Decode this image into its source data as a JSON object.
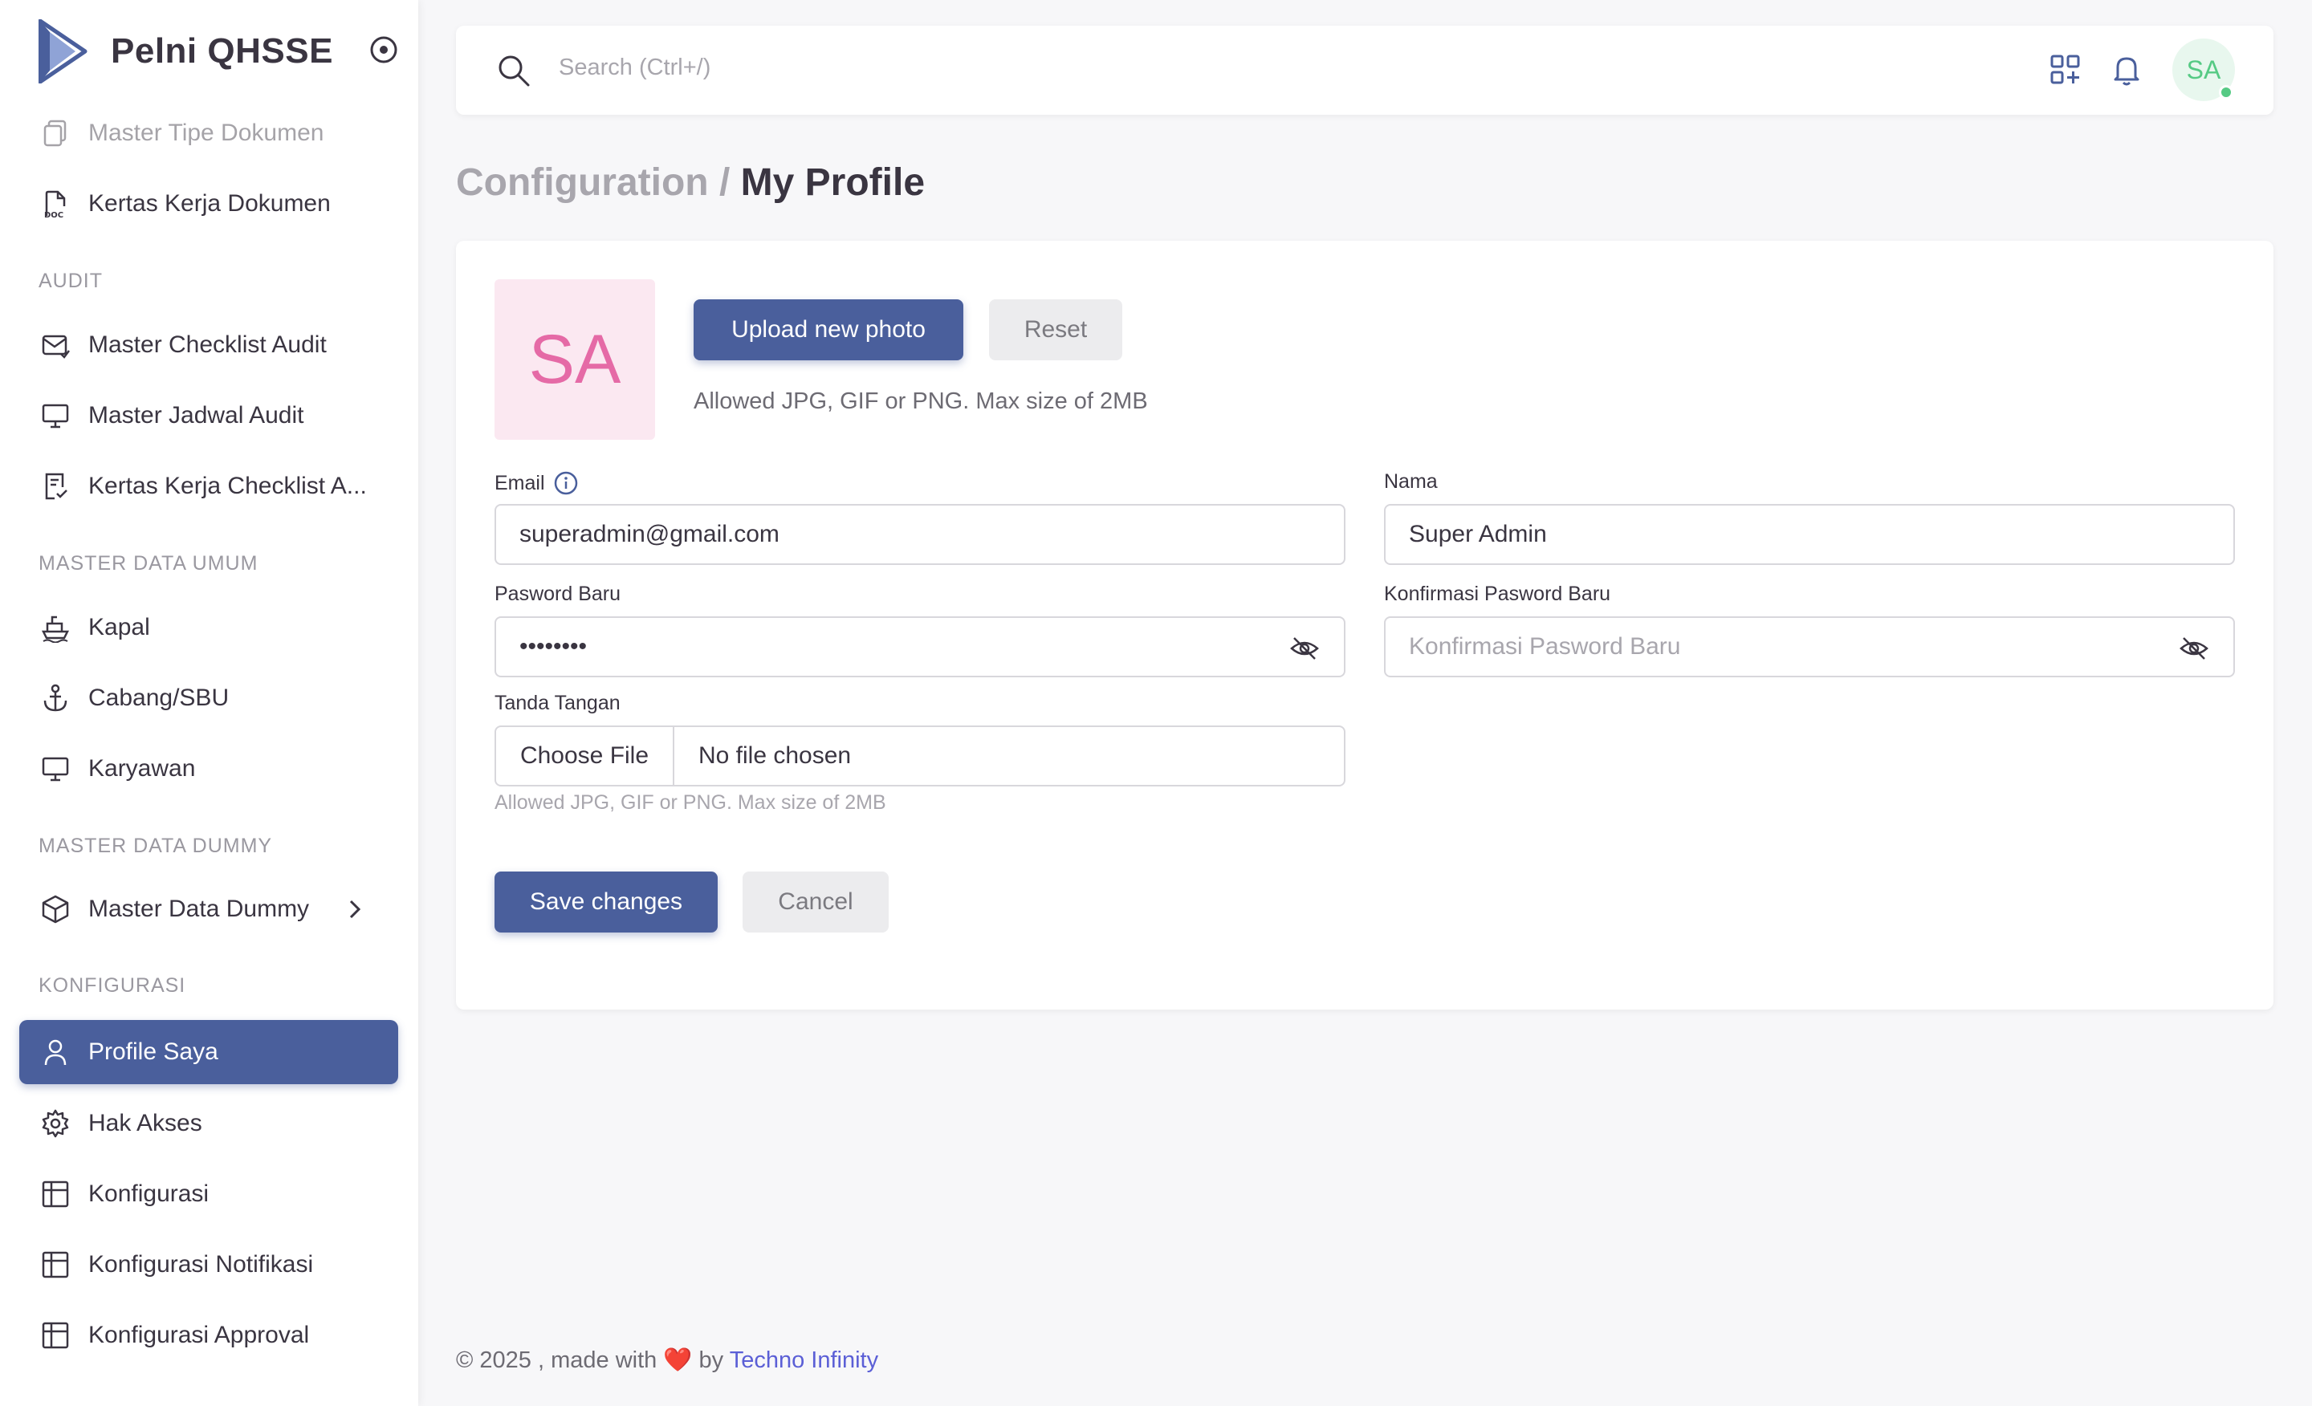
{
  "app": {
    "name": "Pelni QHSSE"
  },
  "sidebar": {
    "items_top": [
      {
        "label": "Master Tipe Dokumen",
        "icon": "documents-icon"
      },
      {
        "label": "Kertas Kerja Dokumen",
        "icon": "doc-file-icon"
      }
    ],
    "sections": {
      "audit": "AUDIT",
      "master_data_umum": "MASTER DATA UMUM",
      "master_data_dummy": "MASTER DATA DUMMY",
      "konfigurasi": "KONFIGURASI"
    },
    "audit_items": [
      {
        "label": "Master Checklist Audit",
        "icon": "mail-check-icon"
      },
      {
        "label": "Master Jadwal Audit",
        "icon": "monitor-icon"
      },
      {
        "label": "Kertas Kerja Checklist A...",
        "icon": "checklist-file-icon"
      }
    ],
    "umum_items": [
      {
        "label": "Kapal",
        "icon": "ship-icon"
      },
      {
        "label": "Cabang/SBU",
        "icon": "anchor-icon"
      },
      {
        "label": "Karyawan",
        "icon": "monitor-icon"
      }
    ],
    "dummy_items": [
      {
        "label": "Master Data Dummy",
        "icon": "box-icon"
      }
    ],
    "konfig_items": [
      {
        "label": "Profile Saya",
        "icon": "user-icon",
        "active": true
      },
      {
        "label": "Hak Akses",
        "icon": "gear-icon"
      },
      {
        "label": "Konfigurasi",
        "icon": "table-icon"
      },
      {
        "label": "Konfigurasi Notifikasi",
        "icon": "table-icon"
      },
      {
        "label": "Konfigurasi Approval",
        "icon": "table-icon"
      }
    ]
  },
  "topbar": {
    "search_placeholder": "Search (Ctrl+/)",
    "avatar_initials": "SA"
  },
  "page": {
    "breadcrumb": "Configuration /",
    "title": "My Profile"
  },
  "profile": {
    "photo_initials": "SA",
    "upload_label": "Upload new photo",
    "reset_label": "Reset",
    "photo_hint": "Allowed JPG, GIF or PNG. Max size of 2MB",
    "email_label": "Email",
    "email_value": "superadmin@gmail.com",
    "nama_label": "Nama",
    "nama_value": "Super Admin",
    "password_label": "Pasword Baru",
    "password_value": "••••••••",
    "confirm_label": "Konfirmasi Pasword Baru",
    "confirm_placeholder": "Konfirmasi Pasword Baru",
    "signature_label": "Tanda Tangan",
    "choose_file_label": "Choose File",
    "no_file_label": "No file chosen",
    "signature_hint": "Allowed JPG, GIF or PNG. Max size of 2MB",
    "save_label": "Save changes",
    "cancel_label": "Cancel"
  },
  "footer": {
    "prefix": "© 2025 , made with",
    "heart": "❤️",
    "by": "by",
    "company": "Techno Infinity"
  },
  "colors": {
    "primary": "#4a5f9c",
    "avatar_green": "#56ca84",
    "photo_pink": "#e56aa6",
    "link": "#5b5fd6"
  }
}
